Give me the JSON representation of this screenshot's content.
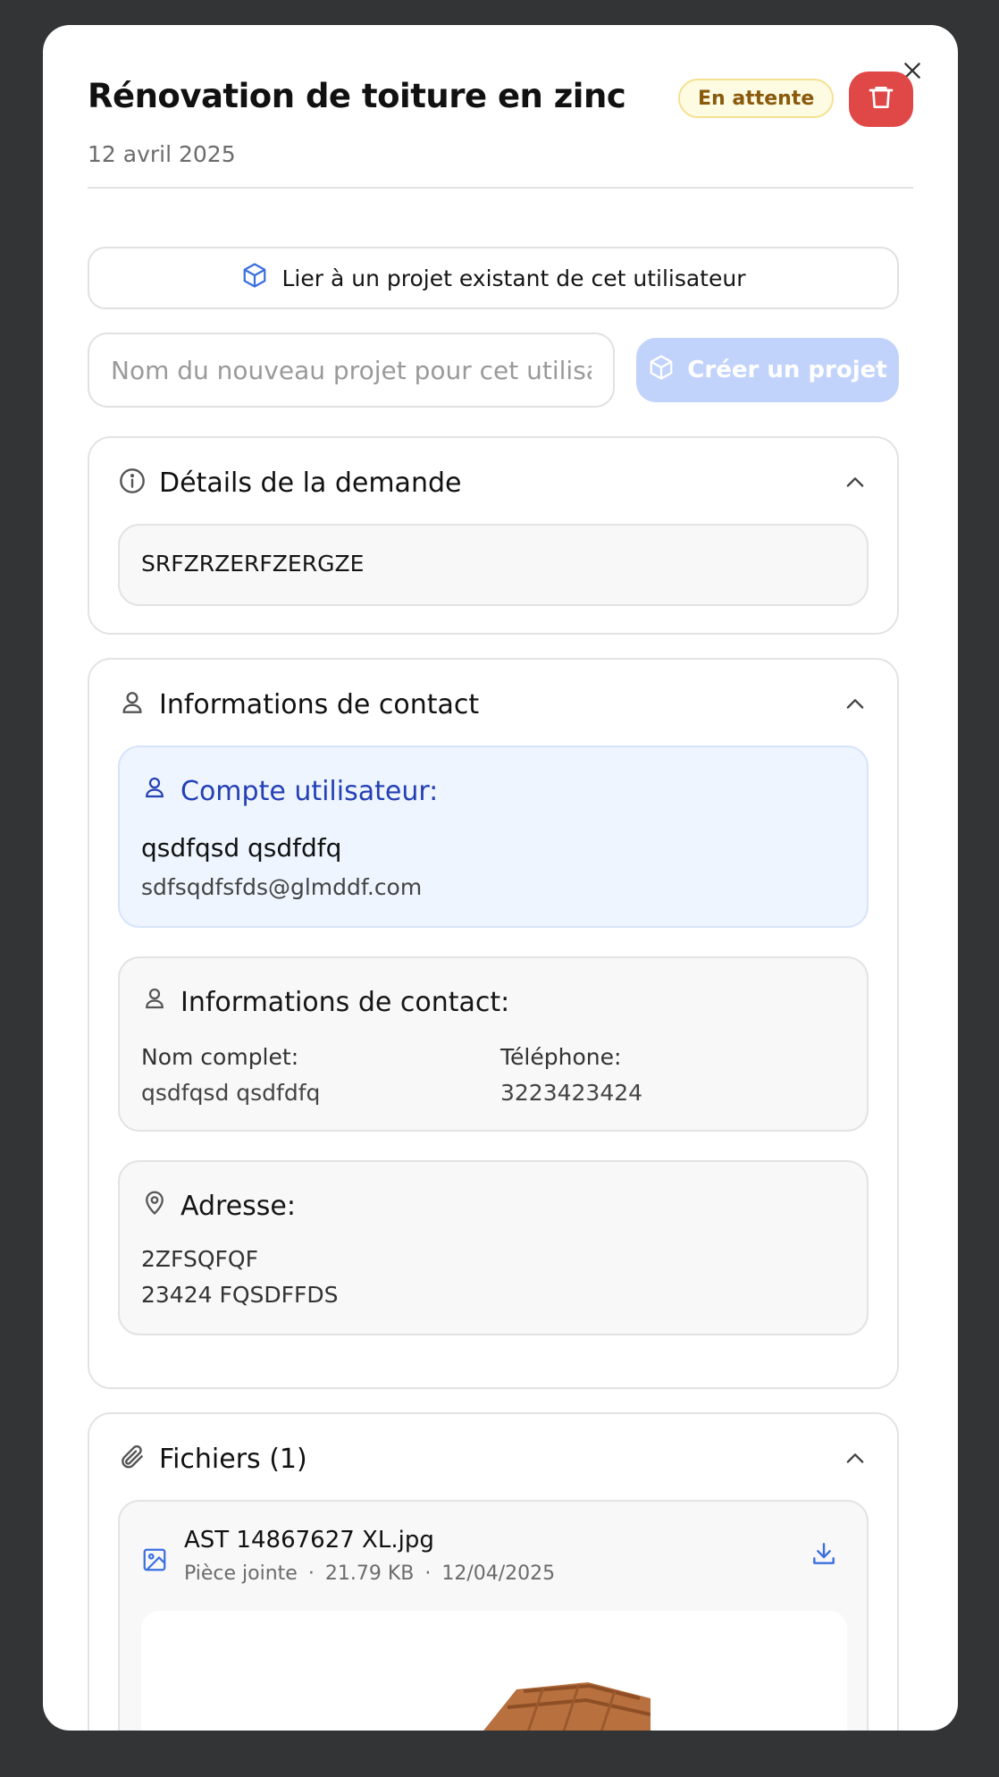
{
  "header": {
    "title": "Rénovation de toiture en zinc",
    "date": "12 avril 2025",
    "status_badge": "En attente"
  },
  "actions": {
    "link_project_label": "Lier à un projet existant de cet utilisateur",
    "new_project_placeholder": "Nom du nouveau projet pour cet utilisateur",
    "new_project_value": "",
    "create_project_label": "Créer un projet"
  },
  "details": {
    "title": "Détails de la demande",
    "content": "SRFZRZERFZERGZE"
  },
  "contact": {
    "title": "Informations de contact",
    "account": {
      "title": "Compte utilisateur:",
      "name": "qsdfqsd qsdfdfq",
      "email": "sdfsqdfsfds@glmddf.com"
    },
    "info": {
      "title": "Informations de contact:",
      "fullname_label": "Nom complet:",
      "fullname_value": "qsdfqsd qsdfdfq",
      "phone_label": "Téléphone:",
      "phone_value": "3223423424"
    },
    "address": {
      "title": "Adresse:",
      "line1": "2ZFSQFQF",
      "line2": "23424 FQSDFFDS"
    }
  },
  "files": {
    "title": "Fichiers (1)",
    "items": [
      {
        "name": "AST 14867627 XL.jpg",
        "type": "Pièce jointe",
        "separator": "·",
        "size": "21.79 KB",
        "date": "12/04/2025"
      }
    ]
  },
  "colors": {
    "badge_bg": "#fefbe3",
    "badge_text": "#8a5a0c",
    "delete_button": "#e04848",
    "primary_disabled": "#c2d3fb",
    "accent_blue": "#2440b3",
    "icon_blue": "#3b6fe0"
  },
  "icons": {
    "close": "close-icon",
    "delete": "trash-icon",
    "link": "cube-icon",
    "details": "info-icon",
    "contact": "user-icon",
    "address": "map-pin-icon",
    "files": "paperclip-icon",
    "file": "image-icon",
    "download": "download-icon",
    "collapse": "chevron-up-icon"
  }
}
